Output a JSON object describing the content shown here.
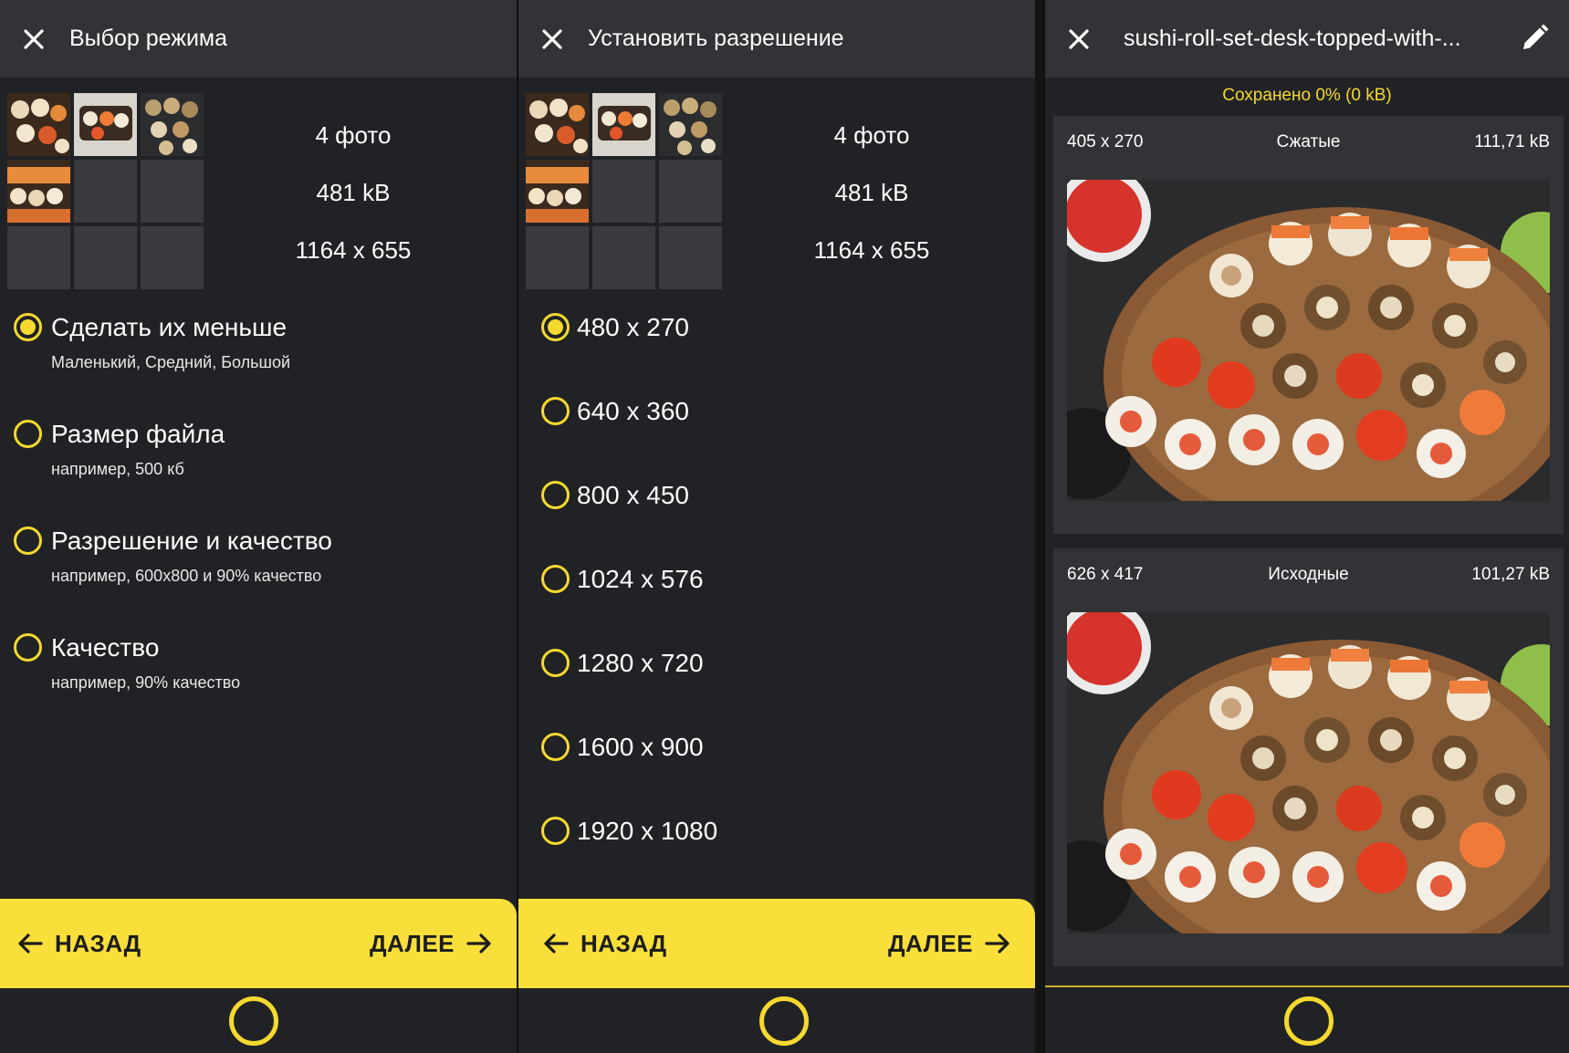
{
  "panel1": {
    "title": "Выбор режима",
    "summary": {
      "photos": "4 фото",
      "size": "481 kB",
      "resolution": "1164 x 655"
    },
    "options": [
      {
        "label": "Сделать их меньше",
        "sub": "Маленький, Средний, Большой",
        "checked": true
      },
      {
        "label": "Размер файла",
        "sub": "например, 500 кб",
        "checked": false
      },
      {
        "label": "Разрешение и качество",
        "sub": "например, 600x800 и 90% качество",
        "checked": false
      },
      {
        "label": "Качество",
        "sub": "например, 90% качество",
        "checked": false
      }
    ],
    "back_label": "НАЗАД",
    "next_label": "ДАЛЕЕ"
  },
  "panel2": {
    "title": "Установить разрешение",
    "summary": {
      "photos": "4 фото",
      "size": "481 kB",
      "resolution": "1164 x 655"
    },
    "resolutions": [
      "480 x 270",
      "640 x 360",
      "800 x 450",
      "1024 x 576",
      "1280 x 720",
      "1600 x 900",
      "1920 x 1080"
    ],
    "selected_index": 0,
    "back_label": "НАЗАД",
    "next_label": "ДАЛЕЕ"
  },
  "panel3": {
    "title": "sushi-roll-set-desk-topped-with-...",
    "saved": "Сохранено 0% (0 kB)",
    "compressed": {
      "dims": "405 x 270",
      "label": "Сжатые",
      "size": "111,71 kB"
    },
    "original": {
      "dims": "626 x 417",
      "label": "Исходные",
      "size": "101,27 kB"
    }
  },
  "icons": {
    "close": "close-icon",
    "edit": "pencil-icon",
    "back": "arrow-left-icon",
    "next": "arrow-right-icon",
    "home": "home-circle-icon"
  },
  "colors": {
    "accent": "#f5d92f",
    "background": "#212226",
    "topbar": "#323337"
  }
}
